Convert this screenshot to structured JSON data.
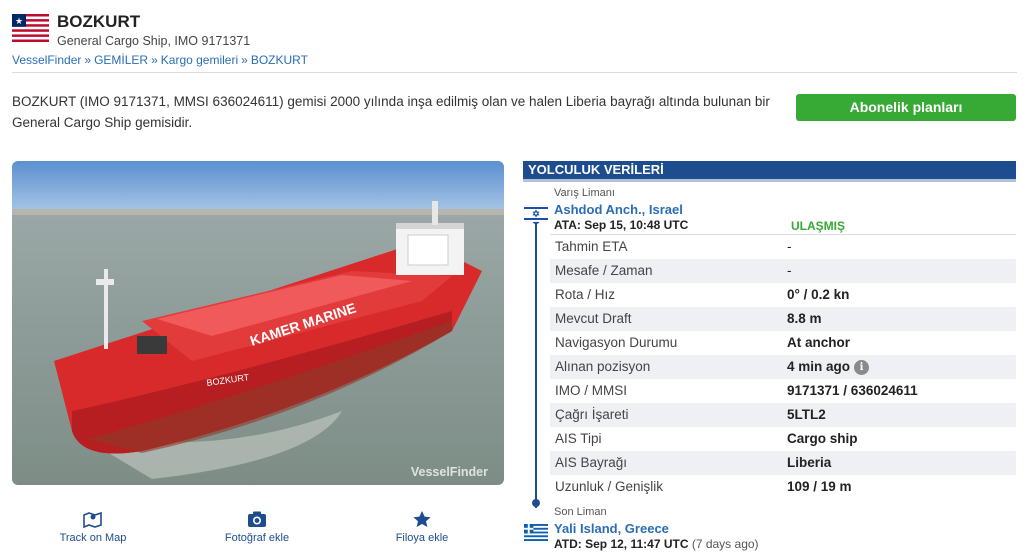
{
  "header": {
    "flag_icon": "liberia-flag",
    "title": "BOZKURT",
    "subtitle": "General Cargo Ship, IMO 9171371",
    "breadcrumb": [
      "VesselFinder",
      "GEMİLER",
      "Kargo gemileri",
      "BOZKURT"
    ],
    "breadcrumb_sep": "»"
  },
  "description": {
    "line1": "BOZKURT (IMO 9171371, MMSI 636024611) gemisi 2000 yılında inşa edilmiş olan ve halen Liberia bayrağı altında bulunan bir",
    "line2": "General Cargo Ship gemisidir."
  },
  "subscribe_button": {
    "label": "Abonelik planları",
    "color": "#37a935"
  },
  "photo": {
    "watermark": "VesselFinder",
    "hull_text": "KAMER MARINE",
    "bow_name": "BOZKURT"
  },
  "actions": [
    {
      "label": "Track on Map",
      "icon": "map-icon"
    },
    {
      "label": "Fotoğraf ekle",
      "icon": "camera-icon"
    },
    {
      "label": "Filoya ekle",
      "icon": "star-icon"
    }
  ],
  "voyage": {
    "heading": "YOLCULUK VERİLERİ",
    "accent_color": "#1d4d8e",
    "destination": {
      "label": "Varış Limanı",
      "port": "Ashdod Anch., Israel",
      "flag_icon": "israel-flag",
      "time": "ATA: Sep 15, 10:48 UTC",
      "status": "ULAŞMIŞ"
    },
    "rows": [
      {
        "key": "Tahmin ETA",
        "value": "-"
      },
      {
        "key": "Mesafe / Zaman",
        "value": "-"
      },
      {
        "key": "Rota / Hız",
        "value": "0° / 0.2 kn"
      },
      {
        "key": "Mevcut Draft",
        "value": "8.8 m"
      },
      {
        "key": "Navigasyon Durumu",
        "value": "At anchor"
      },
      {
        "key": "Alınan pozisyon",
        "value": "4 min ago"
      },
      {
        "key": "IMO / MMSI",
        "value": "9171371 / 636024611"
      },
      {
        "key": "Çağrı İşareti",
        "value": "5LTL2"
      },
      {
        "key": "AIS Tipi",
        "value": "Cargo ship"
      },
      {
        "key": "AIS Bayrağı",
        "value": "Liberia"
      },
      {
        "key": "Uzunluk / Genişlik",
        "value": "109 / 19 m"
      }
    ],
    "info_glyph": "i",
    "last_port": {
      "label": "Son Liman",
      "port": "Yali Island, Greece",
      "flag_icon": "greece-flag",
      "time": "ATD: Sep 12, 11:47 UTC",
      "ago": "(7 days ago)"
    }
  }
}
